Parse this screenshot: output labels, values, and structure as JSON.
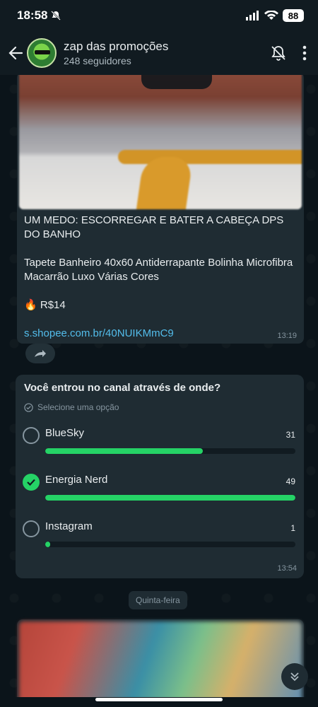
{
  "status_bar": {
    "time": "18:58",
    "battery": "88"
  },
  "header": {
    "channel_name": "zap das promoções",
    "followers": "248 seguidores"
  },
  "message": {
    "headline": "UM MEDO: ESCORREGAR E BATER A CABEÇA DPS DO BANHO",
    "product": "Tapete Banheiro 40x60 Antiderrapante Bolinha Microfibra Macarrão Luxo Várias Cores",
    "price_emoji": "🔥",
    "price": "R$14",
    "link": "s.shopee.com.br/40NUIKMmC9",
    "time": "13:19"
  },
  "poll": {
    "question": "Você entrou no canal através de onde?",
    "hint": "Selecione uma opção",
    "options": [
      {
        "label": "BlueSky",
        "count": "31",
        "fill": 0.63
      },
      {
        "label": "Energia Nerd",
        "count": "49",
        "fill": 1.0,
        "selected": true
      },
      {
        "label": "Instagram",
        "count": "1",
        "fill": 0.02
      }
    ],
    "time": "13:54"
  },
  "date_divider": "Quinta-feira",
  "colors": {
    "accent": "#25d366",
    "link": "#53bdeb",
    "bubble": "#1f2c33",
    "background": "#0b141a"
  }
}
